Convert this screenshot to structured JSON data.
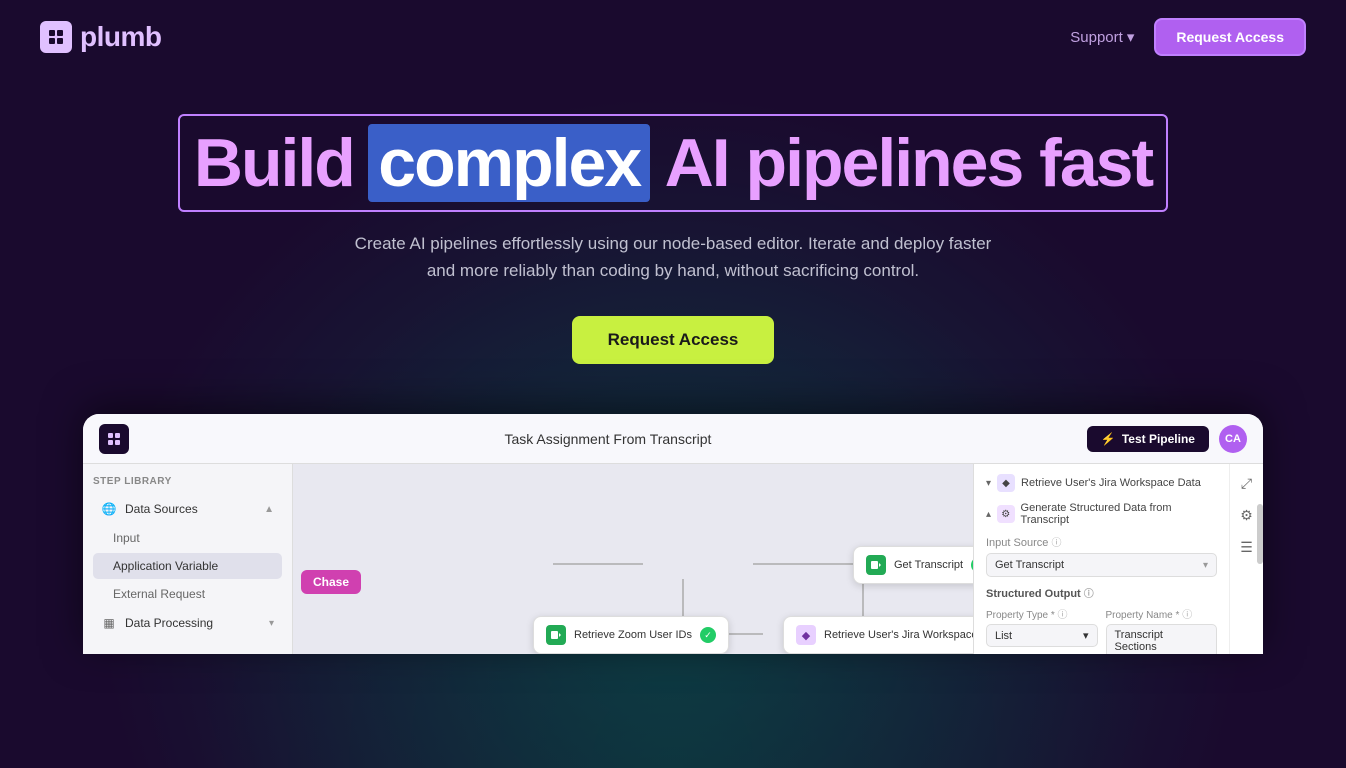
{
  "page": {
    "background": "#1a0a2e"
  },
  "navbar": {
    "logo_text": "plumb",
    "logo_symbol": "▣",
    "support_label": "Support",
    "support_chevron": "▾",
    "request_access_label": "Request Access"
  },
  "hero": {
    "headline_build": "Build",
    "headline_complex": "complex",
    "headline_ai": "AI pipelines fast",
    "subtitle_line1": "Create AI pipelines effortlessly using our node-based editor. Iterate and deploy faster",
    "subtitle_line2": "and more reliably than coding by hand, without sacrificing control.",
    "cta_label": "Request Access"
  },
  "app_preview": {
    "title": "Task Assignment From Transcript",
    "test_pipeline_label": "Test Pipeline",
    "user_initials": "CA",
    "sidebar": {
      "section_title": "STEP LIBRARY",
      "items": [
        {
          "label": "Data Sources",
          "icon": "🌐",
          "expandable": true
        },
        {
          "label": "Input",
          "sub": true
        },
        {
          "label": "Application Variable",
          "sub": true
        },
        {
          "label": "External Request",
          "sub": true
        },
        {
          "label": "Data Processing",
          "icon": "▦",
          "expandable": true
        }
      ]
    },
    "tooltip": "Chase",
    "nodes": [
      {
        "id": "get-transcript",
        "label": "Get Transcript",
        "icon_bg": "#22aa55",
        "icon": "▶",
        "has_check": true
      },
      {
        "id": "retrieve-zoom",
        "label": "Retrieve Zoom User IDs",
        "icon_bg": "#22aa55",
        "icon": "▶",
        "has_check": true
      },
      {
        "id": "retrieve-jira",
        "label": "Retrieve User's Jira Workspace Data",
        "icon_bg": "#e8a0ff",
        "icon": "◆",
        "has_check": true
      }
    ],
    "right_panel": {
      "section1_label": "Retrieve User's Jira Workspace Data",
      "section2_label": "Generate Structured Data from Transcript",
      "input_source_label": "Input Source",
      "input_source_value": "Get Transcript",
      "structured_output_label": "Structured Output",
      "property_type_label": "Property Type *",
      "property_type_value": "List",
      "property_name_label": "Property Name *",
      "property_name_value": "Transcript Sections"
    }
  }
}
